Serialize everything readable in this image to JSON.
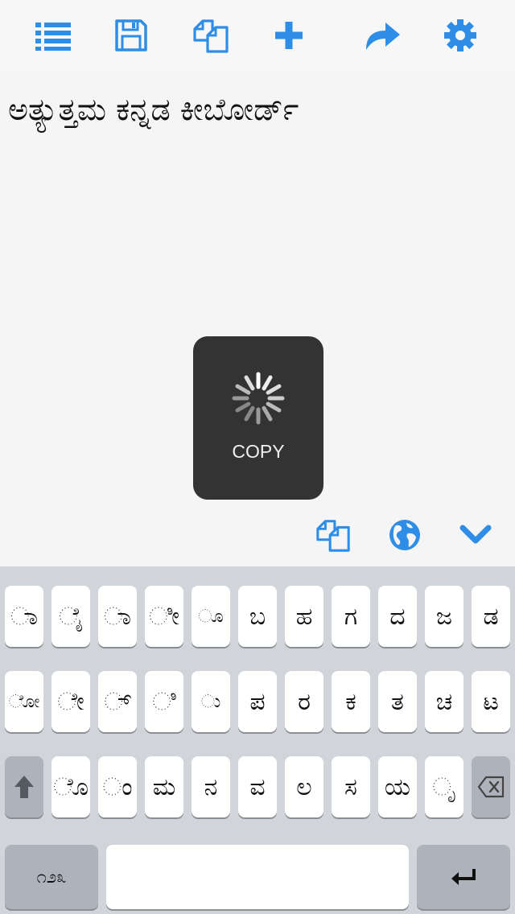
{
  "toolbar": {
    "items": [
      {
        "icon": "list-icon"
      },
      {
        "icon": "save-icon"
      },
      {
        "icon": "copy-icon"
      },
      {
        "icon": "plus-icon"
      },
      {
        "icon": "share-icon"
      },
      {
        "icon": "gear-icon"
      }
    ],
    "accent": "#2e8de6"
  },
  "editor": {
    "text": "ಅತ್ಯುತ್ತಮ ಕನ್ನಡ ಕೀಬೋರ್ಡ್"
  },
  "hud": {
    "label": "COPY"
  },
  "accessory": {
    "items": [
      {
        "icon": "copy-icon"
      },
      {
        "icon": "globe-icon"
      },
      {
        "icon": "chevron-down-icon"
      }
    ]
  },
  "keyboard": {
    "row1": [
      "ಾ",
      "ೈ",
      "ಾ",
      "ೀ",
      "ೂ",
      "ಬ",
      "ಹ",
      "ಗ",
      "ದ",
      "ಜ",
      "ಡ"
    ],
    "row2": [
      "ೋ",
      "ೇ",
      "್",
      "ಿ",
      "ು",
      "ಪ",
      "ರ",
      "ಕ",
      "ತ",
      "ಚ",
      "ಟ"
    ],
    "row3": [
      "ೊ",
      "ಂ",
      "ಮ",
      "ನ",
      "ವ",
      "ಲ",
      "ಸ",
      "ಯ",
      "ೃ"
    ],
    "numbers_label": "೧೨೩",
    "space_label": "",
    "colors": {
      "background": "#d1d4d9",
      "key": "#ffffff",
      "special_key": "#aeb3bb"
    }
  }
}
